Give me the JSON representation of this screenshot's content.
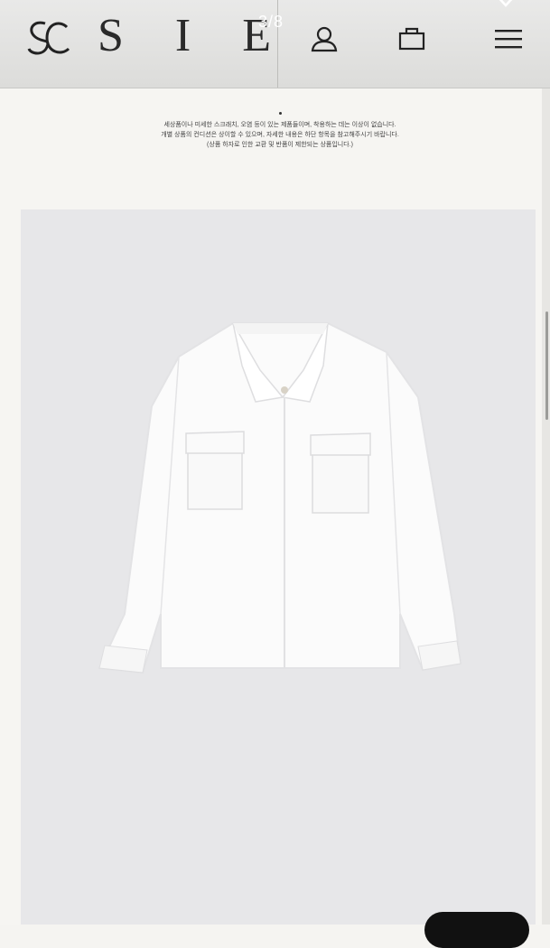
{
  "header": {
    "brand": "S I E",
    "counter_top": "",
    "counter": "3/8",
    "icons": [
      "logo-monogram-icon",
      "user-icon",
      "shopping-bag-icon",
      "menu-icon",
      "close-icon"
    ]
  },
  "notice": {
    "lines": [
      "세상품이나 미세한 스크래치, 오염 등이 있는 제품들이며, 착용하는 데는 이상이 없습니다.",
      "개별 상품의 컨디션은 상이할 수 있으며, 자세한 내용은 하단 항목을 참고해주시기 바랍니다.",
      "(상품 하자로 인한 교환 및 반품이 제한되는 상품입니다.)"
    ]
  },
  "product_image": {
    "description_icon": "white-jacket-image"
  },
  "colors": {
    "header_bg": "#e2e2e0",
    "page_bg": "#f6f5f2",
    "photo_bg": "#e7e7e9"
  }
}
